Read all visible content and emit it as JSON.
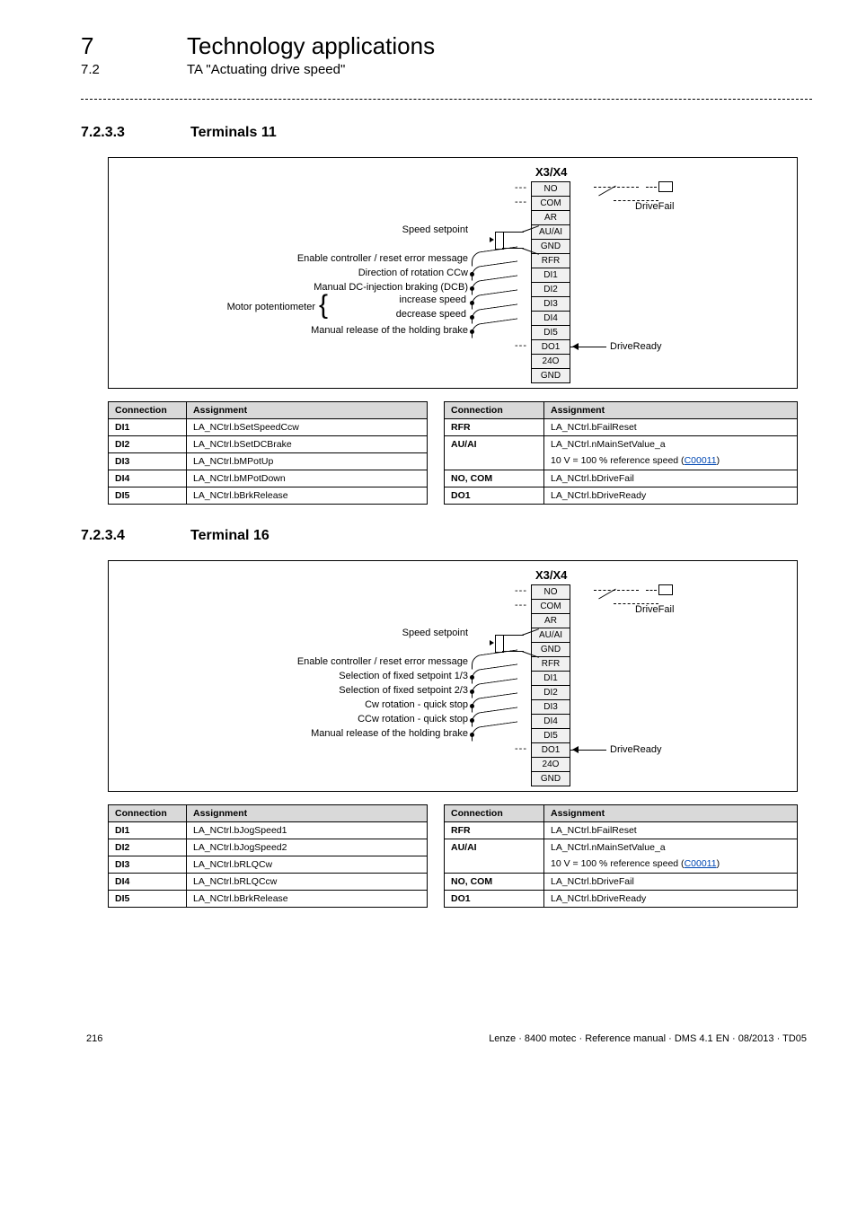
{
  "header": {
    "chapter_num": "7",
    "chapter_title": "Technology applications",
    "section_num": "7.2",
    "section_title": "TA \"Actuating drive speed\""
  },
  "block1": {
    "sec_num": "7.2.3.3",
    "sec_title": "Terminals 11",
    "diagram": {
      "title": "X3/X4",
      "pins": [
        "NO",
        "COM",
        "AR",
        "AU/AI",
        "GND",
        "RFR",
        "DI1",
        "DI2",
        "DI3",
        "DI4",
        "DI5",
        "DO1",
        "24O",
        "GND"
      ],
      "labels": {
        "setpoint": "Speed setpoint",
        "enable": "Enable controller / reset error message",
        "dir": "Direction of rotation CCw",
        "dcb": "Manual DC-injection braking (DCB)",
        "mpot": "Motor potentiometer",
        "mpot_inc": "increase speed",
        "mpot_dec": "decrease speed",
        "brake": "Manual release of the holding brake",
        "drive_ready": "DriveReady",
        "drive_fail": "DriveFail"
      }
    },
    "left_table": [
      [
        "DI1",
        "LA_NCtrl.bSetSpeedCcw"
      ],
      [
        "DI2",
        "LA_NCtrl.bSetDCBrake"
      ],
      [
        "DI3",
        "LA_NCtrl.bMPotUp"
      ],
      [
        "DI4",
        "LA_NCtrl.bMPotDown"
      ],
      [
        "DI5",
        "LA_NCtrl.bBrkRelease"
      ]
    ],
    "right_table": {
      "rfr": [
        "RFR",
        "LA_NCtrl.bFailReset"
      ],
      "auai_conn": "AU/AI",
      "auai_l1": "LA_NCtrl.nMainSetValue_a",
      "auai_l2_pre": "10 V = 100 % reference speed (",
      "auai_l2_code": "C00011",
      "auai_l2_post": ")",
      "nocom": [
        "NO, COM",
        "LA_NCtrl.bDriveFail"
      ],
      "do1": [
        "DO1",
        "LA_NCtrl.bDriveReady"
      ]
    }
  },
  "block2": {
    "sec_num": "7.2.3.4",
    "sec_title": "Terminal 16",
    "diagram": {
      "title": "X3/X4",
      "pins": [
        "NO",
        "COM",
        "AR",
        "AU/AI",
        "GND",
        "RFR",
        "DI1",
        "DI2",
        "DI3",
        "DI4",
        "DI5",
        "DO1",
        "24O",
        "GND"
      ],
      "labels": {
        "setpoint": "Speed setpoint",
        "enable": "Enable controller / reset error message",
        "sel13": "Selection of fixed setpoint 1/3",
        "sel23": "Selection of fixed setpoint 2/3",
        "cw": "Cw rotation - quick stop",
        "ccw": "CCw rotation - quick stop",
        "brake": "Manual release of the holding brake",
        "drive_ready": "DriveReady",
        "drive_fail": "DriveFail"
      }
    },
    "left_table": [
      [
        "DI1",
        "LA_NCtrl.bJogSpeed1"
      ],
      [
        "DI2",
        "LA_NCtrl.bJogSpeed2"
      ],
      [
        "DI3",
        "LA_NCtrl.bRLQCw"
      ],
      [
        "DI4",
        "LA_NCtrl.bRLQCcw"
      ],
      [
        "DI5",
        "LA_NCtrl.bBrkRelease"
      ]
    ],
    "right_table": {
      "rfr": [
        "RFR",
        "LA_NCtrl.bFailReset"
      ],
      "auai_conn": "AU/AI",
      "auai_l1": "LA_NCtrl.nMainSetValue_a",
      "auai_l2_pre": "10 V = 100 % reference speed (",
      "auai_l2_code": "C00011",
      "auai_l2_post": ")",
      "nocom": [
        "NO, COM",
        "LA_NCtrl.bDriveFail"
      ],
      "do1": [
        "DO1",
        "LA_NCtrl.bDriveReady"
      ]
    }
  },
  "table_headers": {
    "conn": "Connection",
    "assign": "Assignment"
  },
  "footer": {
    "page": "216",
    "info": "Lenze · 8400 motec · Reference manual · DMS 4.1 EN · 08/2013 · TD05"
  }
}
